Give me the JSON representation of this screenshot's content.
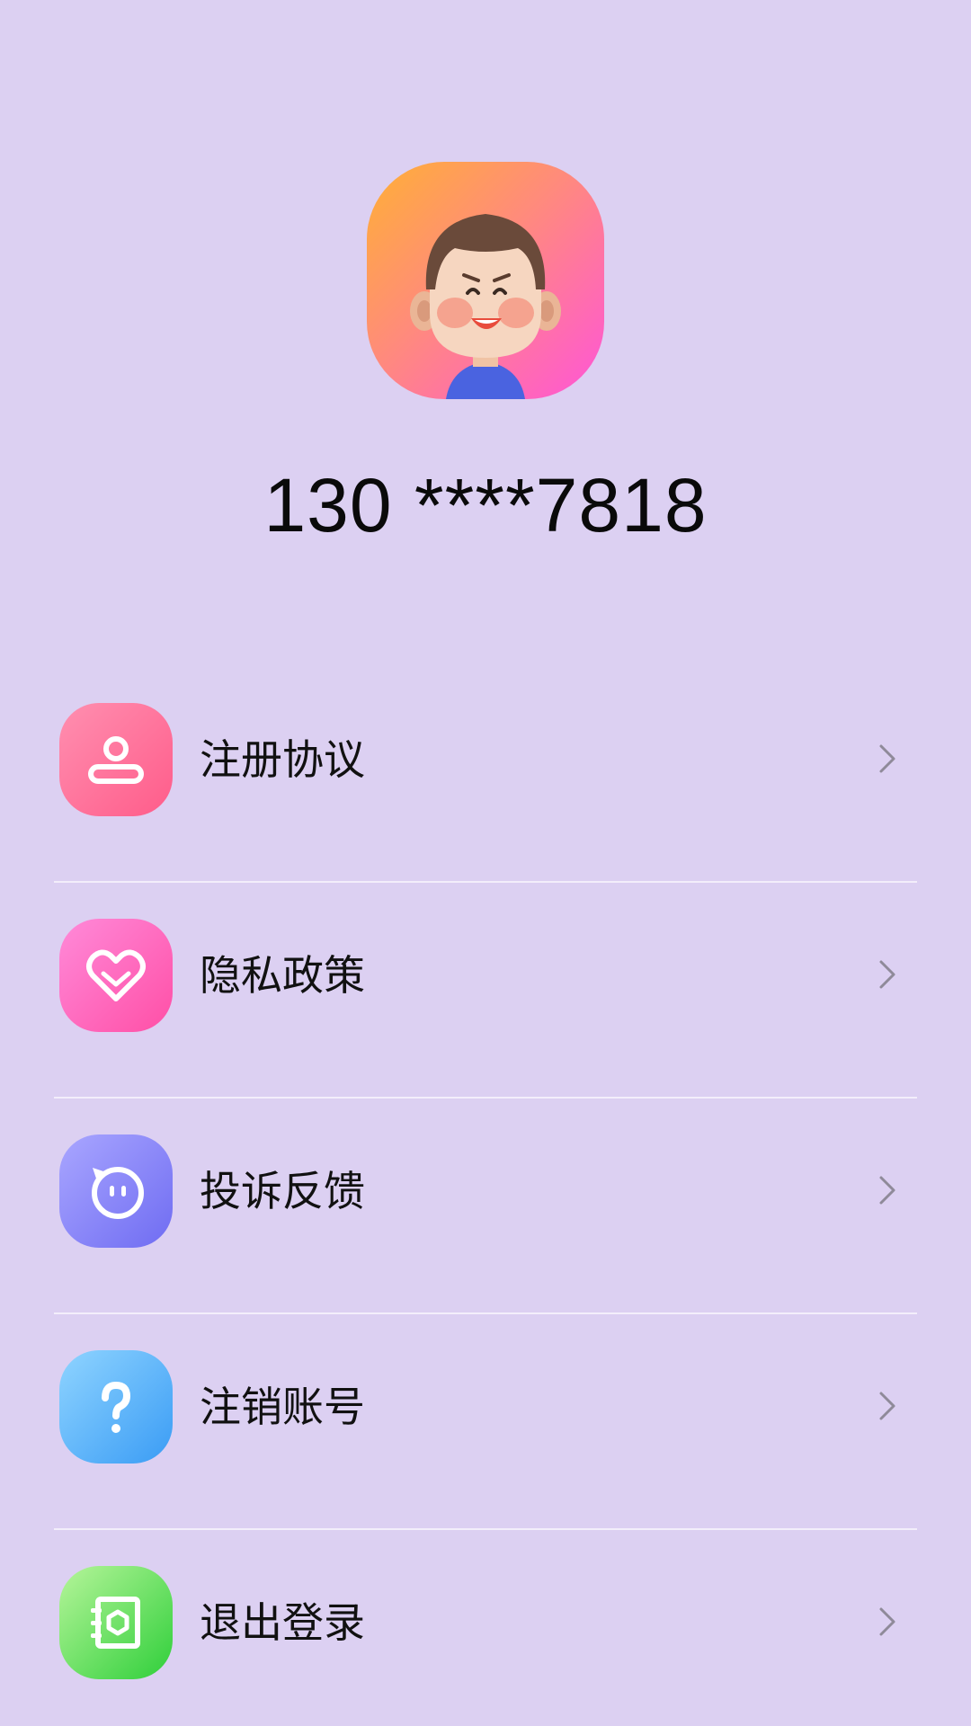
{
  "profile": {
    "phone": "130 ****7818",
    "avatar_icon": "cartoon-boy-avatar"
  },
  "menu": {
    "items": [
      {
        "label": "注册协议",
        "icon": "user-icon",
        "color": "#ff6f96"
      },
      {
        "label": "隐私政策",
        "icon": "heart-icon",
        "color": "#ff5fb8"
      },
      {
        "label": "投诉反馈",
        "icon": "chat-face-icon",
        "color": "#7d7af5"
      },
      {
        "label": "注销账号",
        "icon": "question-icon",
        "color": "#46a6f6"
      },
      {
        "label": "退出登录",
        "icon": "logout-book-icon",
        "color": "#38d443"
      }
    ]
  },
  "colors": {
    "background": "#dcd0f2",
    "divider": "#f3eefb"
  }
}
